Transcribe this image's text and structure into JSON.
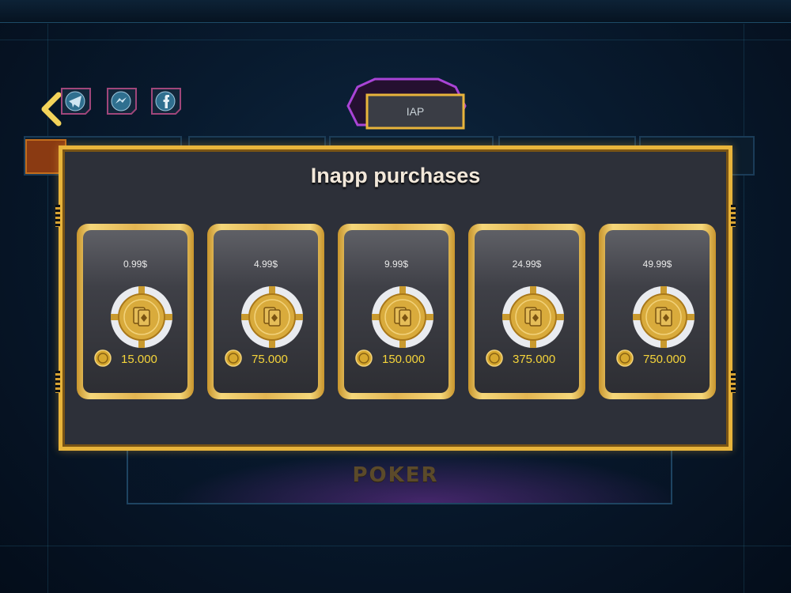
{
  "header": {
    "badge_label": "IAP",
    "social": [
      "telegram-icon",
      "messenger-icon",
      "facebook-icon"
    ]
  },
  "background": {
    "game_label": "POKER"
  },
  "dialog": {
    "title": "Inapp purchases",
    "packages": [
      {
        "price": "0.99$",
        "amount": "15.000"
      },
      {
        "price": "4.99$",
        "amount": "75.000"
      },
      {
        "price": "9.99$",
        "amount": "150.000"
      },
      {
        "price": "24.99$",
        "amount": "375.000"
      },
      {
        "price": "49.99$",
        "amount": "750.000"
      }
    ]
  },
  "colors": {
    "gold": "#e8b43b",
    "coin_text": "#f5d43a",
    "panel": "#2d3039"
  }
}
